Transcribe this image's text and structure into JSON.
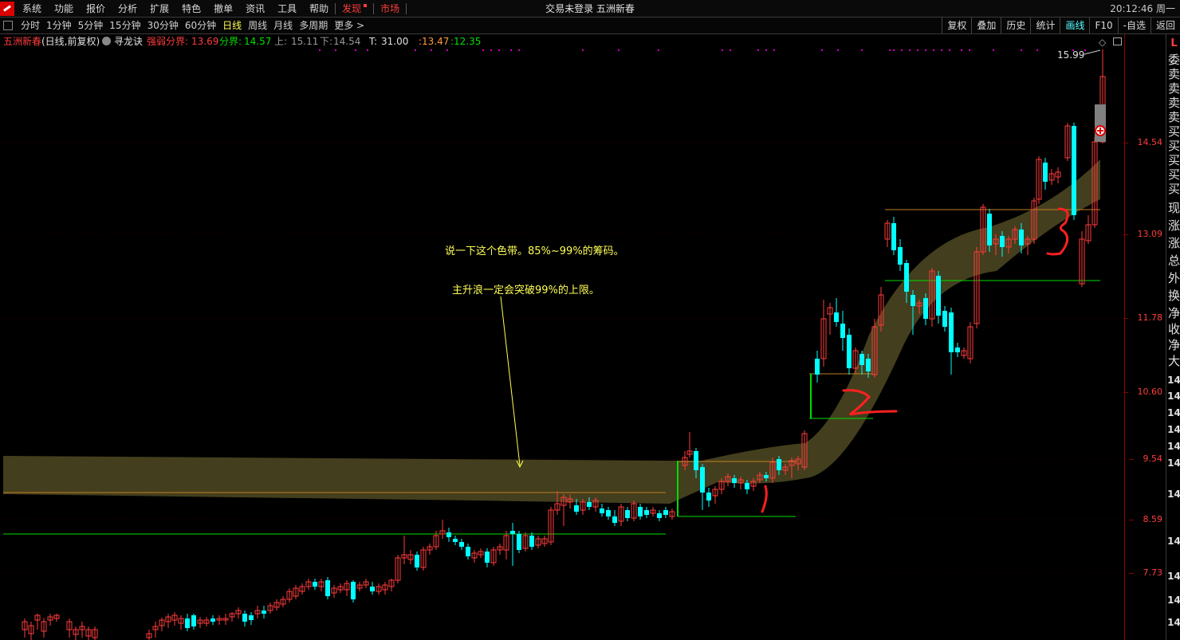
{
  "menubar": {
    "items": [
      "系统",
      "功能",
      "报价",
      "分析",
      "扩展",
      "特色",
      "撤单",
      "资讯",
      "工具",
      "帮助"
    ],
    "discover": "发现",
    "market": "市场",
    "center_title": "交易未登录 五洲新春",
    "clock": "20:12:46 周一"
  },
  "periodbar": {
    "periods": [
      "分时",
      "1分钟",
      "5分钟",
      "15分钟",
      "30分钟",
      "60分钟",
      "日线",
      "周线",
      "月线",
      "多周期",
      "更多 >"
    ],
    "active_period": "日线",
    "tools": [
      "复权",
      "叠加",
      "历史",
      "统计",
      "画线",
      "F10",
      "-自选",
      "返回"
    ],
    "active_tool": "画线"
  },
  "infoline": {
    "stock": "五洲新春",
    "mode": "(日线,前复权)",
    "indicator": "寻龙诀",
    "strong_weak_label": "强弱分界:",
    "strong_weak_value": "13.69",
    "boundary_label": "分界:",
    "boundary_value": "14.57",
    "upper_label": "上:",
    "upper_value": "15.11",
    "lower_label": "下:",
    "lower_value": "14.54",
    "t_label": "T:",
    "t_value": "31.00",
    "r1_value": ":13.47",
    "r2_value": ":12.35"
  },
  "axis": {
    "ticks": [
      "14.54",
      "13.09",
      "11.78",
      "10.60",
      "9.54",
      "8.59",
      "7.73"
    ]
  },
  "sidepanel": {
    "flag": "L",
    "chars": [
      "委",
      "卖",
      "卖",
      "卖",
      "卖",
      "买",
      "买",
      "买",
      "买",
      "买",
      "现",
      "涨",
      "涨",
      "总",
      "外",
      "换",
      "净",
      "收",
      "净",
      "大"
    ],
    "nums": [
      "14",
      "14",
      "14",
      "14",
      "14",
      "14",
      "14",
      "14",
      "14",
      "14",
      "14"
    ]
  },
  "annotations": {
    "note1": "说一下这个色带。85%~99%的筹码。",
    "note2": "主升浪一定会突破99%的上限。",
    "high_price": "15.99",
    "marks": [
      "1",
      "2",
      "3"
    ]
  },
  "colors": {
    "up": "#ff3c3c",
    "down": "#00ffff",
    "band": "#4a4520",
    "band_edge": "#c08020",
    "support_line": "#00dd00",
    "note": "#ffff55"
  },
  "chart_data": {
    "type": "candlestick",
    "price_range": [
      7.3,
      16.2
    ],
    "reference_lines": {
      "upper_band_start": 9.54,
      "lower_support_left": 8.4
    }
  }
}
